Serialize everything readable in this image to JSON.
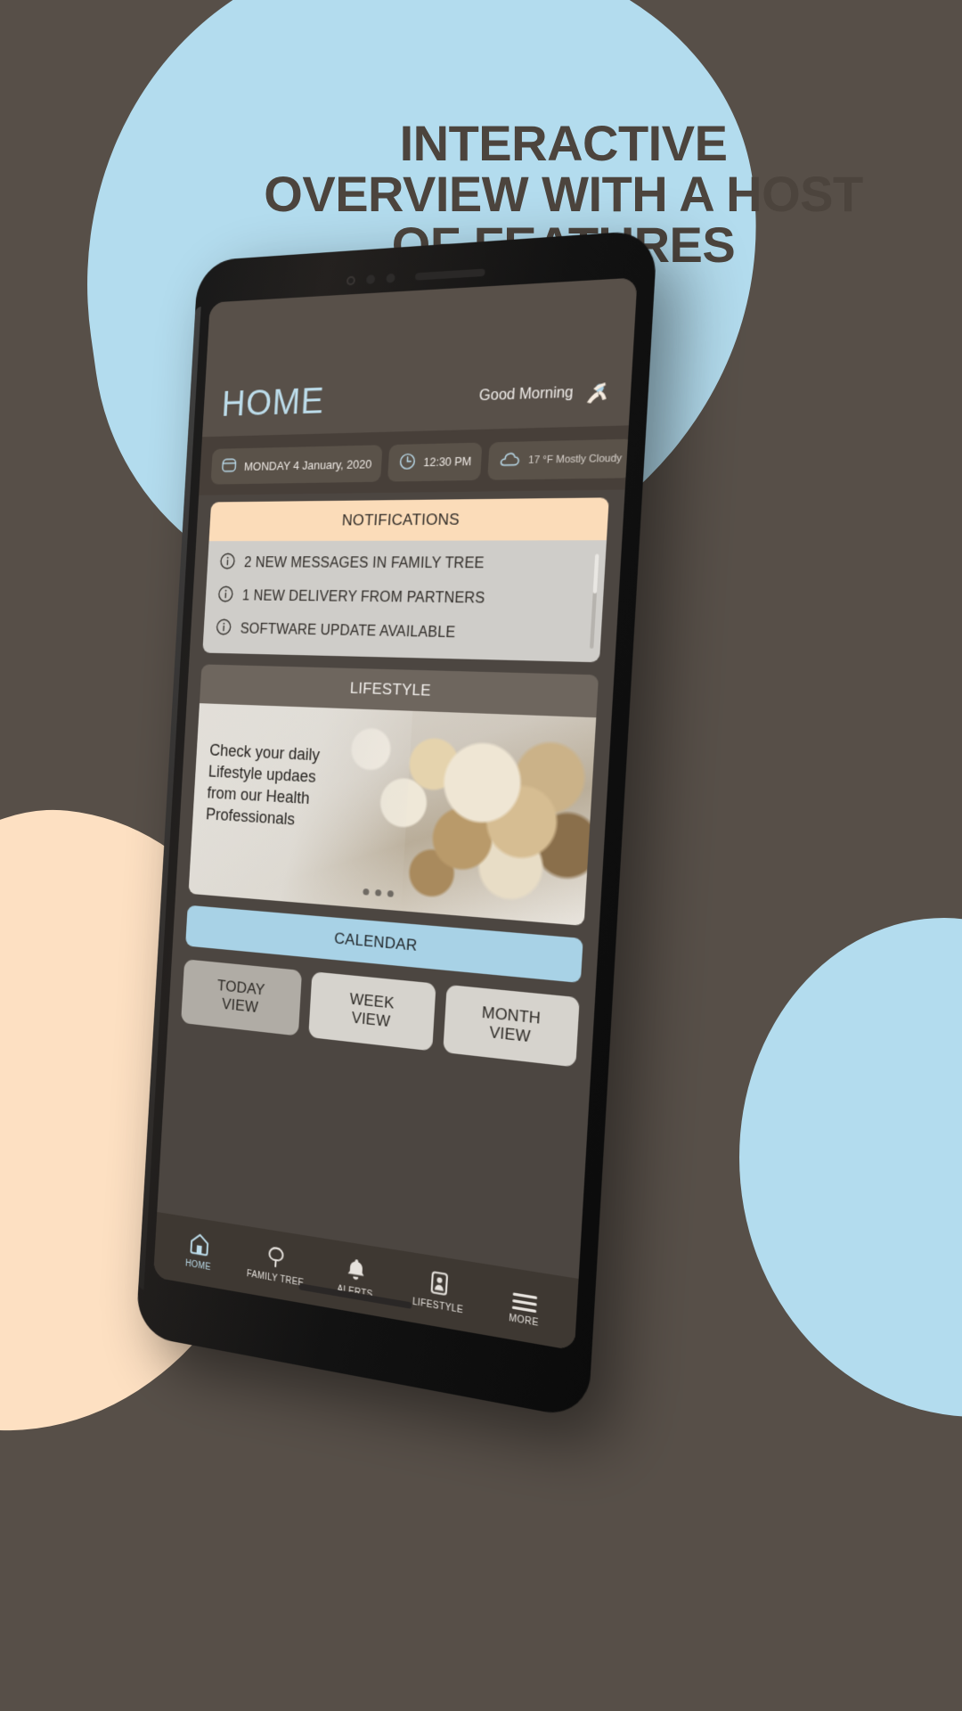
{
  "promo": {
    "headline_lines": [
      "INTERACTIVE",
      "OVERVIEW WITH A HOST",
      "OF FEATURES"
    ],
    "background_color": "#574f48",
    "blob_blue": "#b3dcee",
    "blob_peach": "#fde0c2",
    "headline_color": "#4c443d"
  },
  "app": {
    "title": "HOME",
    "title_color": "#bcdcea",
    "greeting": "Good Morning",
    "greeting_icon": "person-stretching-icon",
    "status_chips": [
      {
        "icon": "calendar-icon",
        "value": "MONDAY 4 January, 2020"
      },
      {
        "icon": "clock-icon",
        "value": "12:30 PM"
      },
      {
        "icon": "cloud-icon",
        "value": "17 °F  Mostly Cloudy"
      }
    ],
    "notifications": {
      "header": "NOTIFICATIONS",
      "header_bg": "#fbdcb9",
      "items": [
        {
          "icon": "info-icon",
          "text": "2 NEW MESSAGES IN FAMILY TREE"
        },
        {
          "icon": "info-icon",
          "text": "1 NEW DELIVERY FROM PARTNERS"
        },
        {
          "icon": "info-icon",
          "text": "SOFTWARE UPDATE AVAILABLE"
        }
      ]
    },
    "lifestyle": {
      "header": "LIFESTYLE",
      "promo_text": "Check your daily Lifestyle updaes from our Health Professionals",
      "carousel_dots": 3
    },
    "calendar": {
      "header": "CALENDAR",
      "header_bg": "#a8d2e6",
      "views": [
        {
          "line1": "TODAY",
          "line2": "VIEW",
          "selected": true
        },
        {
          "line1": "WEEK",
          "line2": "VIEW",
          "selected": false
        },
        {
          "line1": "MONTH",
          "line2": "VIEW",
          "selected": false
        }
      ]
    },
    "tabbar": [
      {
        "icon": "home-icon",
        "label": "HOME",
        "active": true
      },
      {
        "icon": "family-tree-icon",
        "label": "FAMILY TREE",
        "active": false
      },
      {
        "icon": "bell-icon",
        "label": "ALERTS",
        "active": false
      },
      {
        "icon": "person-icon",
        "label": "LIFESTYLE",
        "active": false
      },
      {
        "icon": "menu-icon",
        "label": "MORE",
        "active": false
      }
    ]
  }
}
